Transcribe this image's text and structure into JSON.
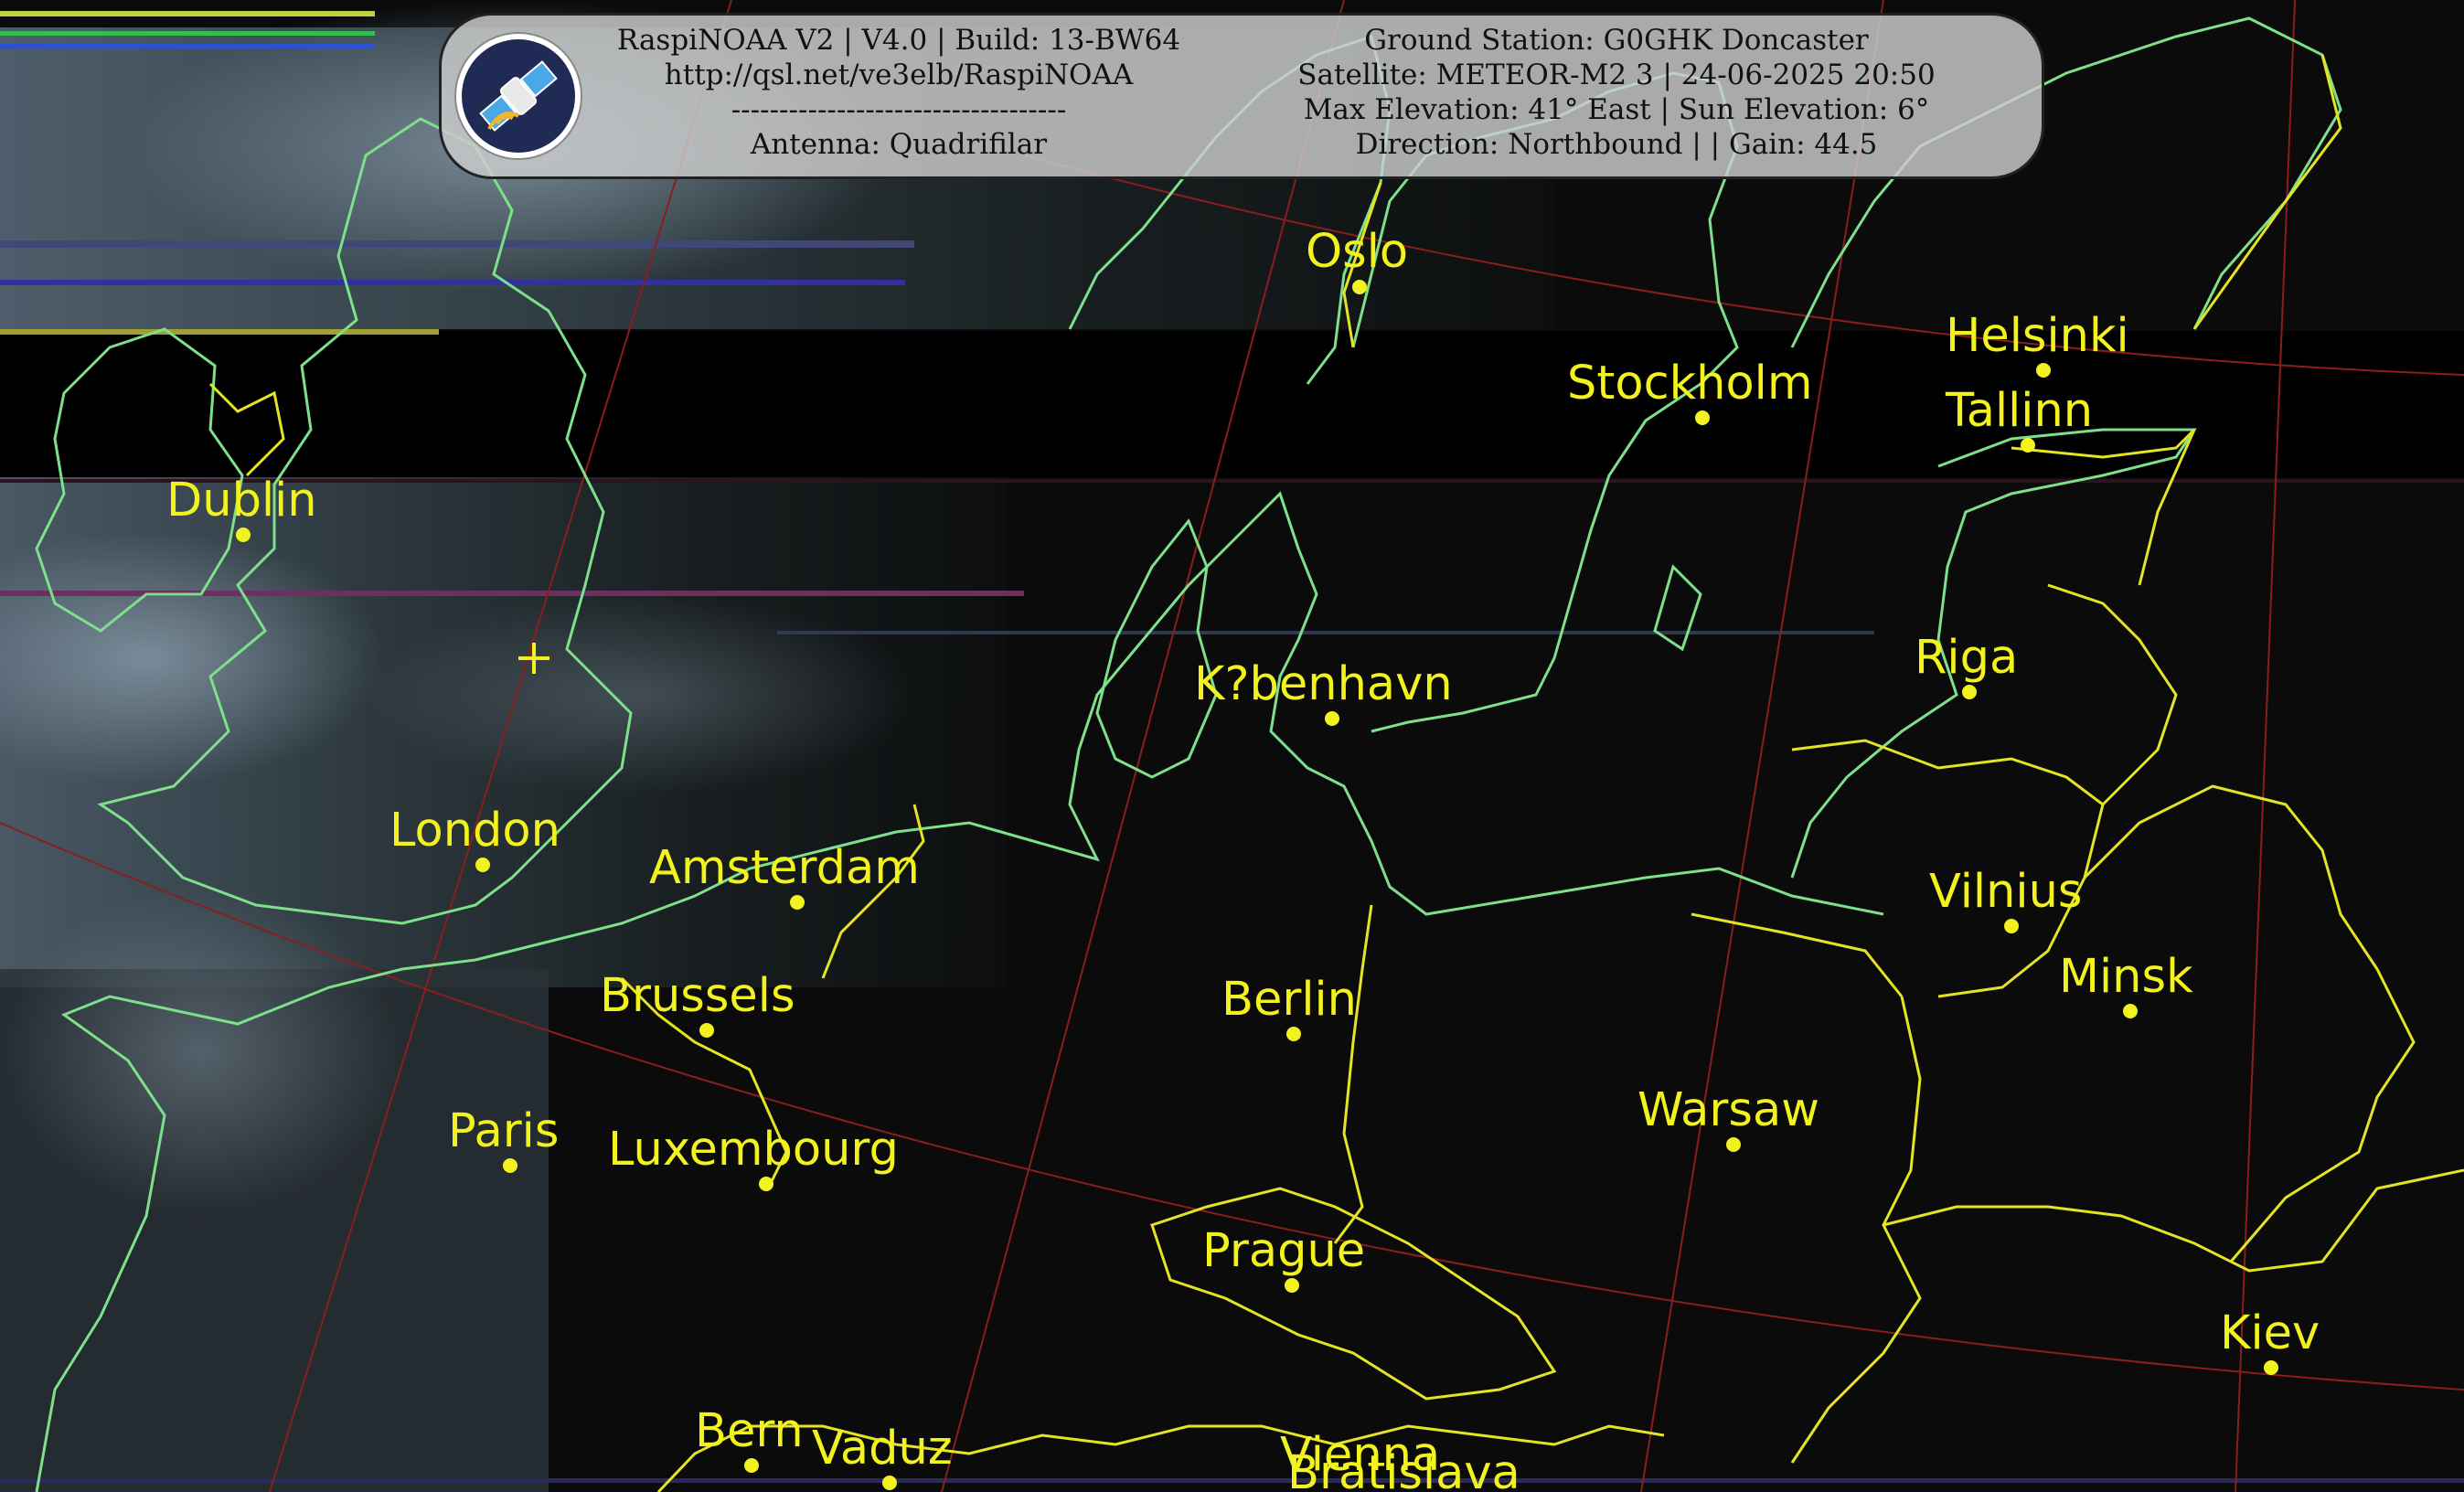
{
  "header": {
    "left_lines": [
      "RaspiNOAA V2 | V4.0 | Build: 13-BW64",
      "http://qsl.net/ve3elb/RaspiNOAA",
      "-----------------------------------",
      "Antenna: Quadrifilar"
    ],
    "right_lines": [
      "Ground Station: G0GHK Doncaster",
      "Satellite: METEOR-M2 3 | 24-06-2025 20:50",
      "Max Elevation: 41° East | Sun Elevation: 6°",
      "Direction: Northbound | | Gain: 44.5"
    ],
    "logo_icon": "satellite-icon"
  },
  "map": {
    "cities": [
      {
        "name": "Oslo"
      },
      {
        "name": "Stockholm"
      },
      {
        "name": "Helsinki"
      },
      {
        "name": "Tallinn"
      },
      {
        "name": "Dublin"
      },
      {
        "name": "Riga"
      },
      {
        "name": "K?benhavn"
      },
      {
        "name": "London"
      },
      {
        "name": "Amsterdam"
      },
      {
        "name": "Vilnius"
      },
      {
        "name": "Brussels"
      },
      {
        "name": "Berlin"
      },
      {
        "name": "Minsk"
      },
      {
        "name": "Paris"
      },
      {
        "name": "Luxembourg"
      },
      {
        "name": "Warsaw"
      },
      {
        "name": "Prague"
      },
      {
        "name": "Kiev"
      },
      {
        "name": "Bern"
      },
      {
        "name": "Vaduz"
      },
      {
        "name": "Vienna"
      },
      {
        "name": "Bratislava"
      }
    ],
    "station_marker": "ground-station-crosshair-icon",
    "colors": {
      "coastline": "#7de08a",
      "border": "#e4e424",
      "city": "#f2f21e",
      "graticule": "#8a1e1e",
      "background": "#0b0b0b"
    }
  }
}
